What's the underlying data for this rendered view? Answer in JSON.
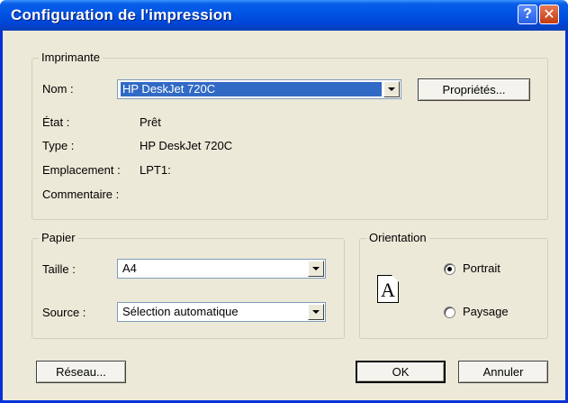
{
  "window": {
    "title": "Configuration de l'impression",
    "help_label": "?",
    "close_label": "✕"
  },
  "printer": {
    "legend": "Imprimante",
    "name_label": "Nom :",
    "name_value": "HP DeskJet 720C",
    "properties_button": "Propriétés...",
    "status_label": "État :",
    "status_value": "Prêt",
    "type_label": "Type :",
    "type_value": "HP DeskJet 720C",
    "location_label": "Emplacement :",
    "location_value": "LPT1:",
    "comment_label": "Commentaire :",
    "comment_value": ""
  },
  "paper": {
    "legend": "Papier",
    "size_label": "Taille :",
    "size_value": "A4",
    "source_label": "Source :",
    "source_value": "Sélection automatique"
  },
  "orientation": {
    "legend": "Orientation",
    "icon_letter": "A",
    "portrait_label": "Portrait",
    "landscape_label": "Paysage",
    "selected": "Portrait"
  },
  "buttons": {
    "network": "Réseau...",
    "ok": "OK",
    "cancel": "Annuler"
  },
  "icons": {
    "help": "help-icon",
    "close": "close-icon",
    "dropdown": "chevron-down-icon",
    "page": "page-portrait-icon"
  }
}
